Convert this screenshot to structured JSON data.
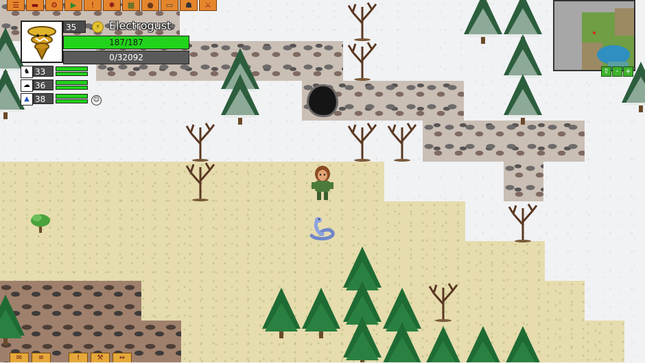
{
  "player": {
    "level": "35",
    "name": "Electrogust",
    "hp_text": "187/187",
    "hp_fraction": 1.0,
    "xp_text": "0/32092",
    "xp_fraction": 0.0,
    "portrait": "whirlwind-creature"
  },
  "party": [
    {
      "level": "33",
      "icon": "gargoyle-icon",
      "hp_fraction": 1.0,
      "energy_fraction": 1.0
    },
    {
      "level": "36",
      "icon": "ghost-icon",
      "hp_fraction": 1.0,
      "energy_fraction": 1.0
    },
    {
      "level": "38",
      "icon": "ice-icon",
      "hp_fraction": 1.0,
      "energy_fraction": 1.0
    }
  ],
  "toolbar": [
    "quest-log-icon",
    "menu-icon",
    "gear-icon",
    "play-icon",
    "alert-icon",
    "figure-icon",
    "map-icon",
    "bag-icon",
    "book-icon",
    "witch-icon",
    "sword-icon"
  ],
  "minimap": {
    "controls": [
      "⇧",
      "-",
      "+"
    ]
  },
  "bottom_bar": [
    "chat-icon",
    "scroll-icon",
    "alert-icon",
    "wrench-icon",
    "arrows-icon"
  ],
  "colors": {
    "hp": "#21d31a",
    "snow": "#f1f2f4",
    "grass": "#e6dcae",
    "rock": "#cabfb5",
    "ui_orange": "#e5862c"
  },
  "creatures": [
    {
      "type": "trader-npc"
    },
    {
      "type": "serpent"
    }
  ]
}
